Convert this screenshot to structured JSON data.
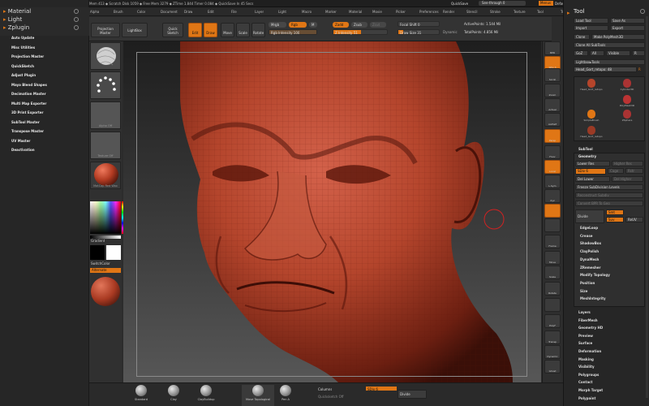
{
  "titlebar": {
    "app": "ZBrush 4R6 P3",
    "doc": "Head_Gort_Kadoos_2",
    "stats": "◆ Active Mem 413 ◆ Scratch Disk 1059 ◆ Free Mem 3279 ◆ ZTime 1.844 Timer 0.084 ◆ QuickSave In 45 Secs",
    "quicksave": "QuickSave",
    "seethrough": "See-through 0",
    "menus_btn": "Menus",
    "script": "DefaultZScript"
  },
  "menubar": {
    "items": [
      "Alpha",
      "Brush",
      "Color",
      "Document",
      "Draw",
      "Edit",
      "File",
      "Layer",
      "Light",
      "Macro",
      "Marker",
      "Material",
      "Movie",
      "Picker",
      "Preferences",
      "Render",
      "Stencil",
      "Stroke",
      "Texture",
      "Tool",
      "Transform",
      "Zoogle",
      "Zscript"
    ]
  },
  "left_palette": {
    "sections": [
      {
        "label": "Material"
      },
      {
        "label": "Light"
      },
      {
        "label": "Zplugin"
      }
    ],
    "plugins": [
      "Auto Update",
      "Misc Utilities",
      "Projection Master",
      "QuickSketch",
      "Adjust Plugin",
      "Maya Blend Shapes",
      "Decimation Master",
      "Multi Map Exporter",
      "3D Print Exporter",
      "SubTool Master",
      "Transpose Master",
      "UV Master",
      "Deactivation"
    ]
  },
  "shelf": {
    "projection_master": "Projection Master",
    "lightbox": "LightBox",
    "quick_sketch": "Quick Sketch",
    "edit": "Edit",
    "draw": "Draw",
    "move": "Move",
    "scale": "Scale",
    "rotate": "Rotate",
    "mrgb": "Mrgb",
    "rgb": "Rgb",
    "m": "M",
    "rgb_intensity": "Rgb Intensity 100",
    "zadd": "Zadd",
    "zsub": "Zsub",
    "zcut": "Zcut",
    "z_intensity": "Z Intensity 51",
    "focal_shift": "Focal Shift 0",
    "draw_size": "Draw Size 31",
    "dynamic": "Dynamic",
    "active_points": "ActivePoints: 1.544 Mil",
    "total_points": "TotalPoints: 4.856 Mil"
  },
  "left_strip": {
    "thumbs": [
      "",
      "",
      "Alpha Off",
      "Texture Off",
      "MatCap Red Wax"
    ],
    "gradient": "Gradient",
    "switch_color": "SwitchColor",
    "alternate": "Alternate"
  },
  "right_strip": {
    "buttons": [
      "BPR",
      "SPix 3",
      "Scroll",
      "Zoom",
      "Actual",
      "AAHalf",
      "Persp",
      "Floor",
      "Local",
      "L.Sym",
      "Xyz",
      "",
      "",
      "Frame",
      "Move",
      "Scale",
      "Rotate",
      "",
      "PolyF",
      "Transp",
      "Dynamic",
      "Ghost",
      "Solo"
    ]
  },
  "tool_panel": {
    "title": "Tool",
    "buttons": [
      [
        "Load Tool",
        "Save As"
      ],
      [
        "Import",
        "Export"
      ],
      [
        "Clone",
        "Make PolyMesh3D"
      ],
      [
        "Clone All SubTools"
      ],
      [
        "GoZ",
        "All",
        "Visible",
        "R"
      ]
    ],
    "lightbox_tools": "Lightbox▸Tools",
    "current_tool": "Head_Gort_retopo: 48",
    "tools": [
      "Head_Gort_retopo",
      "Cylinder3D",
      "PolyMesh3D",
      "SimpleBrush",
      "ZSphere",
      "Head_Gort_retopo"
    ],
    "subtool": "SubTool",
    "geometry": "Geometry",
    "lower_res": "Lower Res",
    "higher_res": "Higher Res",
    "sdiv": "SDiv 6",
    "cage": "Cage",
    "rstr": "Rstr",
    "del_lower": "Del Lower",
    "del_higher": "Del Higher",
    "freeze": "Freeze SubDivision Levels",
    "reconstruct": "Reconstruct Subdiv",
    "convert_bpr": "Convert BPR To Geo",
    "divide": "Divide",
    "smt": "Smt",
    "suv": "Suv",
    "reuv": "ReUV",
    "sections": [
      "EdgeLoop",
      "Crease",
      "ShadowBox",
      "ClayPolish",
      "DynaMesh",
      "ZRemesher",
      "Modify Topology",
      "Position",
      "Size",
      "MeshIntegrity"
    ],
    "lower_sections": [
      "Layers",
      "FiberMesh",
      "Geometry HD",
      "Preview",
      "Surface",
      "Deformation",
      "Masking",
      "Visibility",
      "Polygroups",
      "Contact",
      "Morph Target",
      "Polypaint"
    ]
  },
  "bottom": {
    "brushes": [
      "Standard",
      "Clay",
      "ClayBuildup",
      "Move Topological",
      "Pen A"
    ],
    "columns": "Columns",
    "sdiv": "SDiv 6",
    "divide": "Divide",
    "quick_sketch": "Quicksketch Off"
  },
  "colors": {
    "accent": "#e07615",
    "skin": "#b5452b"
  }
}
